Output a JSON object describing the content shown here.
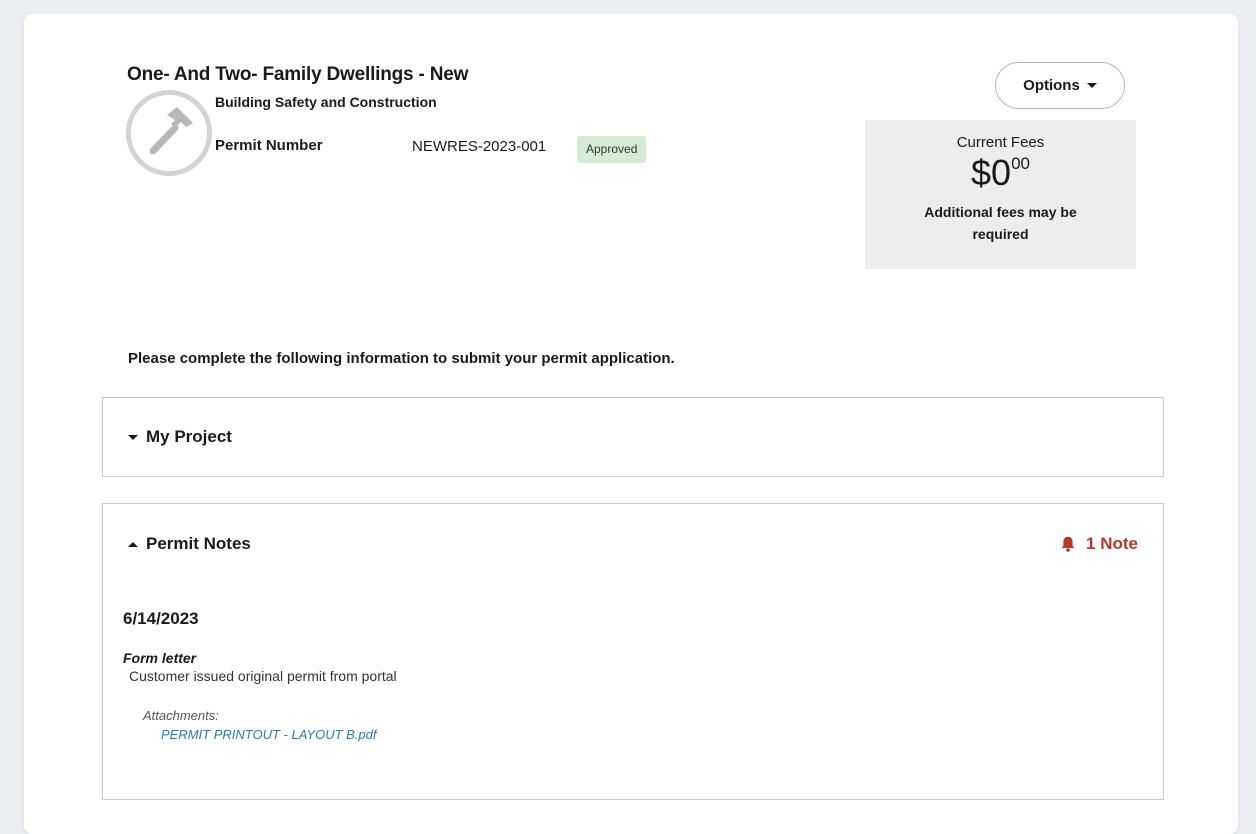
{
  "permit": {
    "title": "One- And Two- Family Dwellings - New",
    "department": "Building Safety and Construction",
    "icon": "hammer-icon",
    "number_label": "Permit Number",
    "number_value": "NEWRES-2023-001",
    "status": "Approved"
  },
  "options": {
    "label": "Options"
  },
  "fees": {
    "label": "Current Fees",
    "dollars": "$0",
    "cents": "00",
    "note": "Additional fees may be required"
  },
  "instructions": "Please complete the following information to submit your permit application.",
  "sections": {
    "project": {
      "title": "My Project",
      "expanded": false
    },
    "notes": {
      "title": "Permit Notes",
      "expanded": true,
      "count_label": "1 Note",
      "items": [
        {
          "date": "6/14/2023",
          "type": "Form letter",
          "text": "Customer issued original permit from portal",
          "attachments_label": "Attachments:",
          "attachments": [
            "PERMIT PRINTOUT - LAYOUT B.pdf"
          ]
        }
      ]
    }
  },
  "colors": {
    "page_background": "#eaedf1",
    "status_badge_bg": "#d6ead6",
    "fees_box_bg": "#ededed",
    "alert_red": "#b03a2e",
    "link_blue": "#2a7ab8"
  }
}
